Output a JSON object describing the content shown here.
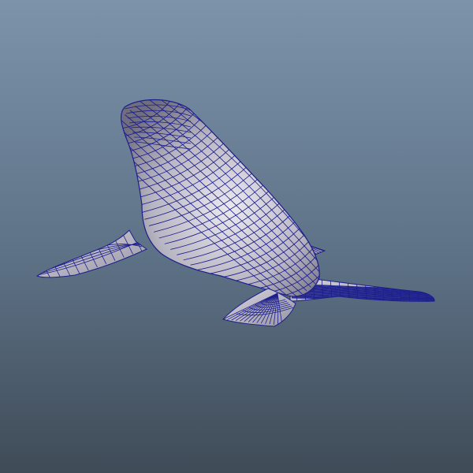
{
  "viewport": {
    "background_top": "#7c93aa",
    "background_mid": "#5d7186",
    "background_bottom": "#3f4b57"
  },
  "model": {
    "subject": "seal",
    "display_mode": "wireframe-on-shaded",
    "shade_light": "#ebe9ef",
    "shade_mid": "#b9b6c3",
    "shade_dark": "#6f6d7e",
    "wire_color": "#1c1f8c"
  }
}
